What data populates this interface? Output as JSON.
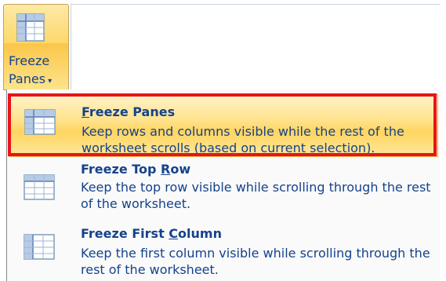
{
  "ribbon": {
    "button_label_line1": "Freeze",
    "button_label_line2": "Panes",
    "dropdown_arrow": "▾",
    "icon": "freeze-panes-icon"
  },
  "menu": {
    "items": [
      {
        "title": "Freeze Panes",
        "access_key": "F",
        "description": "Keep rows and columns visible while the rest of the worksheet scrolls (based on current selection).",
        "icon": "freeze-panes-icon",
        "highlighted": true
      },
      {
        "title": "Freeze Top Row",
        "access_key": "R",
        "description": "Keep the top row visible while scrolling through the rest of the worksheet.",
        "icon": "freeze-top-row-icon",
        "highlighted": false
      },
      {
        "title": "Freeze First Column",
        "access_key": "C",
        "description": "Keep the first column visible while scrolling through the rest of the worksheet.",
        "icon": "freeze-first-column-icon",
        "highlighted": false
      }
    ]
  },
  "colors": {
    "highlight_border": "#e8141a",
    "text": "#15428b",
    "hover_fill": "#ffe38f"
  }
}
